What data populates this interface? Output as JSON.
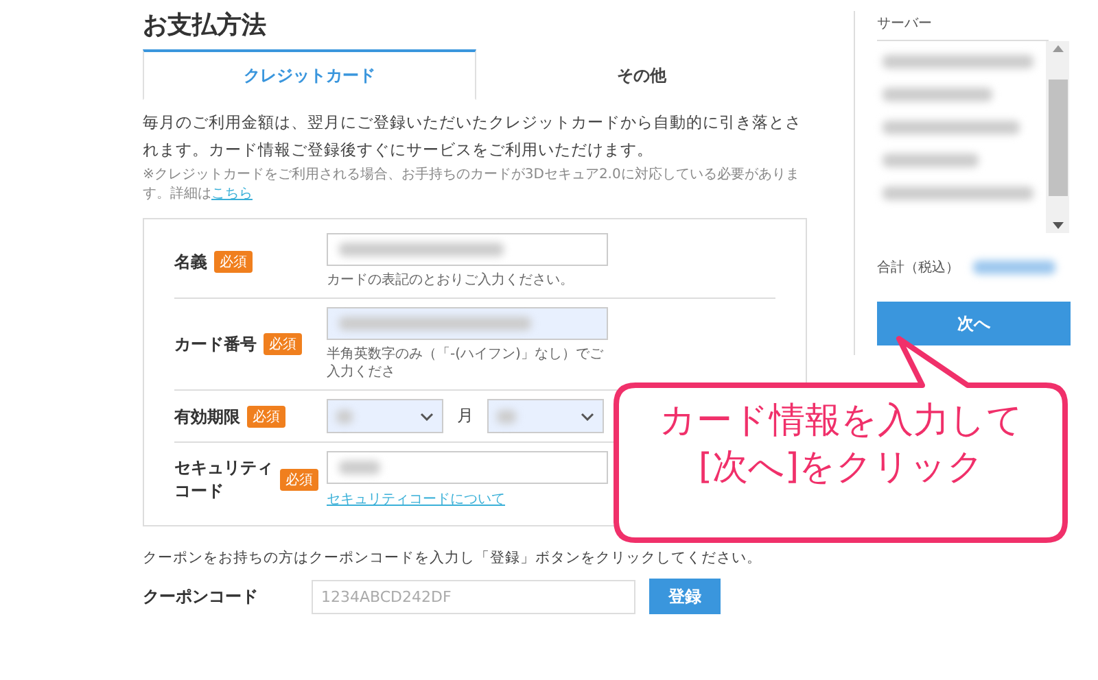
{
  "page_title": "お支払方法",
  "tabs": [
    {
      "label": "クレジットカード",
      "selected": true
    },
    {
      "label": "その他",
      "selected": false
    }
  ],
  "description": "毎月のご利用金額は、翌月にご登録いただいたクレジットカードから自動的に引き落とされます。カード情報ご登録後すぐにサービスをご利用いただけます。",
  "note": {
    "text": "※クレジットカードをご利用される場合、お手持ちのカードが3Dセキュア2.0に対応している必要があります。詳細は",
    "link": "こちら"
  },
  "form": {
    "fields": [
      {
        "label": "名義",
        "badge": "必須",
        "kind": "text",
        "autofilled": false,
        "hint": "カードの表記のとおりご入力ください。"
      },
      {
        "label": "カード番号",
        "badge": "必須",
        "kind": "text",
        "autofilled": true,
        "hint": "半角英数字のみ（「-(ハイフン)」なし）でご入力くださ"
      },
      {
        "label": "有効期限",
        "badge": "必須",
        "kind": "select",
        "autofilled": true,
        "units": [
          "月"
        ]
      },
      {
        "label": "セキュリティコード",
        "badge": "必須",
        "kind": "text",
        "autofilled": false,
        "link": "セキュリティコードについて"
      }
    ]
  },
  "coupon": {
    "text": "クーポンをお持ちの方はクーポンコードを入力し「登録」ボタンをクリックしてください。",
    "label": "クーポンコード",
    "placeholder": "1234ABCD242DF",
    "button": "登録"
  },
  "sidebar": {
    "heading": "サーバー",
    "total_label": "合計（税込）",
    "next_button": "次へ"
  },
  "callout": {
    "lines": [
      "カード情報を入力して",
      "[次へ]をクリック"
    ]
  }
}
